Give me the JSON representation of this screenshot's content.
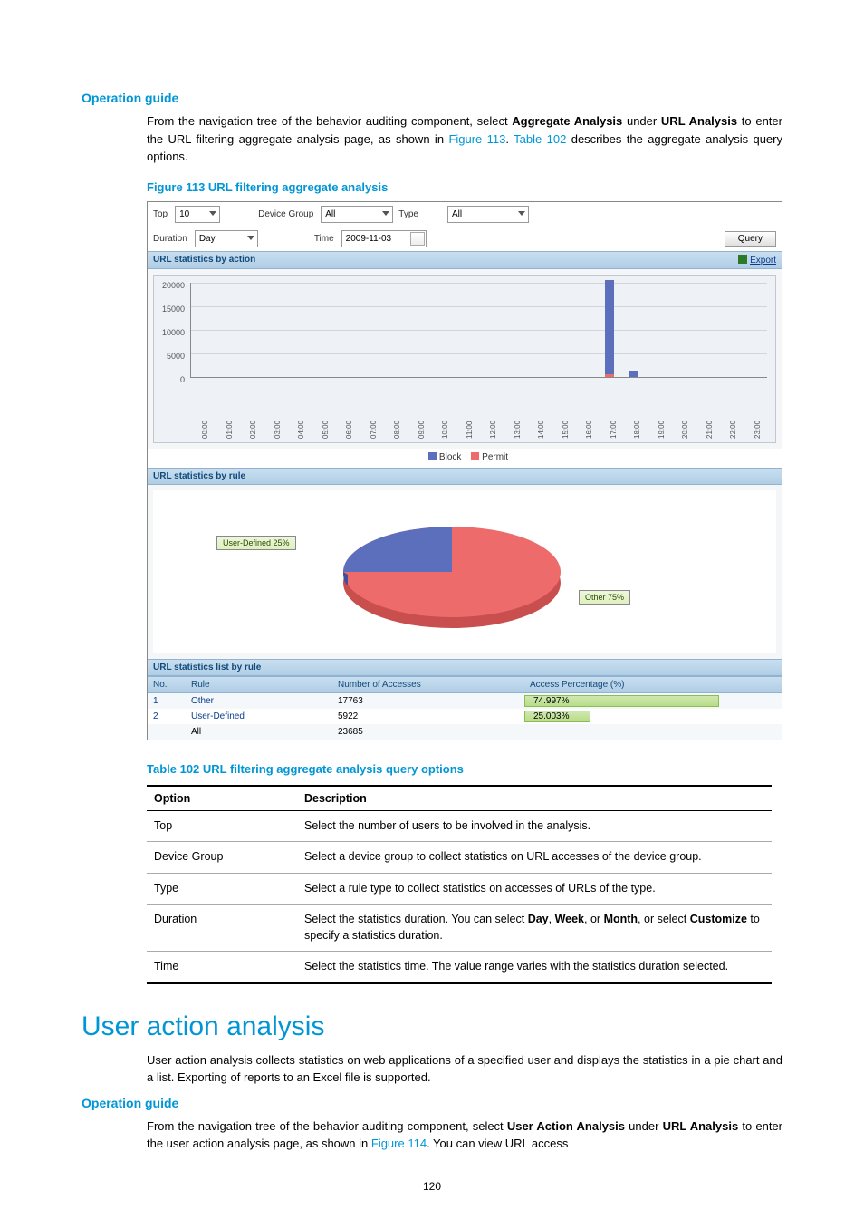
{
  "headings": {
    "opguide1": "Operation guide",
    "opguide2": "Operation guide",
    "section": "User action analysis"
  },
  "paragraphs": {
    "p1a": "From the navigation tree of the behavior auditing component, select ",
    "p1b": "Aggregate Analysis",
    "p1c": " under ",
    "p1d": "URL Analysis",
    "p1e": " to enter the URL filtering aggregate analysis page, as shown in ",
    "p1f": "Figure 113",
    "p1g": ". ",
    "p1h": "Table 102",
    "p1i": " describes the aggregate analysis query options.",
    "p2": "User action analysis collects statistics on web applications of a specified user and displays the statistics in a pie chart and a list. Exporting of reports to an Excel file is supported.",
    "p3a": "From the navigation tree of the behavior auditing component, select ",
    "p3b": "User Action Analysis",
    "p3c": " under ",
    "p3d": "URL Analysis",
    "p3e": " to enter the user action analysis page, as shown in ",
    "p3f": "Figure 114",
    "p3g": ". You can view URL access"
  },
  "figure113_caption": "Figure 113 URL filtering aggregate analysis",
  "table102_caption": "Table 102 URL filtering aggregate analysis query options",
  "filters": {
    "top_label": "Top",
    "top_value": "10",
    "devgrp_label": "Device Group",
    "devgrp_value": "All",
    "type_label": "Type",
    "type_value": "All",
    "duration_label": "Duration",
    "duration_value": "Day",
    "time_label": "Time",
    "time_value": "2009-11-03",
    "query": "Query"
  },
  "panels": {
    "by_action": "URL statistics by action",
    "by_rule": "URL statistics by rule",
    "list_by_rule": "URL statistics list by rule",
    "export": "Export"
  },
  "chart_data": {
    "bar": {
      "type": "bar",
      "ylabel": "",
      "xlabel": "",
      "ylim": [
        0,
        20000
      ],
      "y_ticks": [
        "20000",
        "15000",
        "10000",
        "5000",
        "0"
      ],
      "categories": [
        "00:00",
        "01:00",
        "02:00",
        "03:00",
        "04:00",
        "05:00",
        "06:00",
        "07:00",
        "08:00",
        "09:00",
        "10:00",
        "11:00",
        "12:00",
        "13:00",
        "14:00",
        "15:00",
        "16:00",
        "17:00",
        "18:00",
        "19:00",
        "20:00",
        "21:00",
        "22:00",
        "23:00"
      ],
      "series": [
        {
          "name": "Block",
          "color": "#5b6fbc",
          "values": [
            0,
            0,
            0,
            0,
            0,
            0,
            0,
            0,
            0,
            0,
            0,
            0,
            0,
            0,
            0,
            0,
            0,
            22000,
            1200,
            0,
            0,
            0,
            0,
            0
          ]
        },
        {
          "name": "Permit",
          "color": "#ee6b6b",
          "values": [
            0,
            0,
            0,
            0,
            0,
            0,
            0,
            0,
            0,
            0,
            0,
            0,
            0,
            0,
            0,
            0,
            0,
            500,
            0,
            0,
            0,
            0,
            0,
            0
          ]
        }
      ],
      "legend": {
        "block": "Block",
        "permit": "Permit"
      }
    },
    "pie": {
      "type": "pie",
      "slices": [
        {
          "name": "Other",
          "value": 75,
          "label": "Other 75%",
          "color": "#ee6b6b"
        },
        {
          "name": "User-Defined",
          "value": 25,
          "label": "User-Defined 25%",
          "color": "#5b6fbc"
        }
      ]
    }
  },
  "list": {
    "cols": {
      "no": "No.",
      "rule": "Rule",
      "acc": "Number of Accesses",
      "pct": "Access Percentage (%)"
    },
    "rows": [
      {
        "no": "1",
        "rule": "Other",
        "acc": "17763",
        "pct": "74.997%",
        "pctw": 75
      },
      {
        "no": "2",
        "rule": "User-Defined",
        "acc": "5922",
        "pct": "25.003%",
        "pctw": 25
      }
    ],
    "total": {
      "no": "",
      "rule": "All",
      "acc": "23685",
      "pct": ""
    }
  },
  "table102": {
    "head": {
      "opt": "Option",
      "desc": "Description"
    },
    "rows": [
      {
        "opt": "Top",
        "desc": "Select the number of users to be involved in the analysis."
      },
      {
        "opt": "Device Group",
        "desc": "Select a device group to collect statistics on URL accesses of the device group."
      },
      {
        "opt": "Type",
        "desc": "Select a rule type to collect statistics on accesses of URLs of the type."
      },
      {
        "opt": "Duration",
        "desc_pre": "Select the statistics duration. You can select ",
        "b1": "Day",
        "m1": ", ",
        "b2": "Week",
        "m2": ", or ",
        "b3": "Month",
        "m3": ", or select ",
        "b4": "Customize",
        "desc_post": " to specify a statistics duration."
      },
      {
        "opt": "Time",
        "desc": "Select the statistics time. The value range varies with the statistics duration selected."
      }
    ]
  },
  "page_number": "120"
}
